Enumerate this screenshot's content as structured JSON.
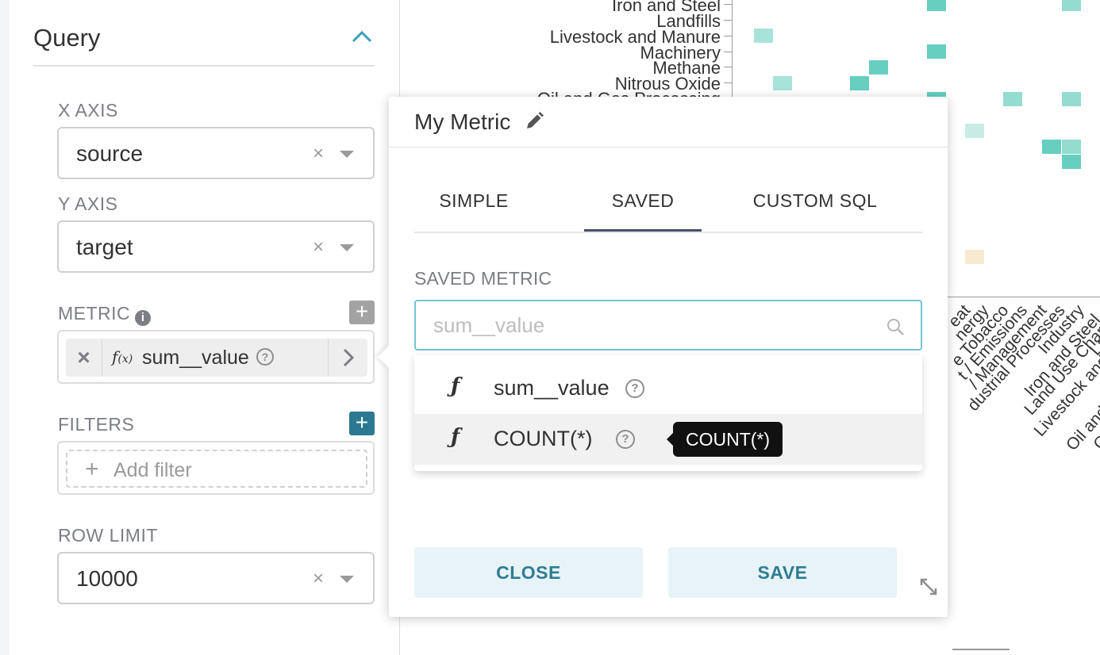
{
  "query": {
    "title": "Query",
    "x_axis": {
      "label": "X AXIS",
      "value": "source",
      "clear": "×"
    },
    "y_axis": {
      "label": "Y AXIS",
      "value": "target",
      "clear": "×"
    },
    "metric": {
      "label": "METRIC",
      "info": "i",
      "add": "+",
      "remove": "×",
      "fx": "f",
      "fx_sub": "(x)",
      "value": "sum__value",
      "help": "?"
    },
    "filters": {
      "label": "FILTERS",
      "add": "+",
      "add_plus": "+",
      "add_label": "Add filter"
    },
    "row_limit": {
      "label": "ROW LIMIT",
      "value": "10000",
      "clear": "×"
    }
  },
  "chart": {
    "y_labels": [
      "Iron and Steel",
      "Landfills",
      "Livestock and Manure",
      "Machinery",
      "Methane",
      "Nitrous Oxide",
      "Oil and Gas Processing"
    ],
    "x_labels": [
      "eat",
      "nergy",
      "e Tobacco",
      "t / Emissions",
      "/ Management",
      "dustrial Processes",
      "Industry",
      "Iron and Steel",
      "Land Use Chan",
      "Livestock and",
      "La",
      "Oil and",
      "O"
    ],
    "colors": {
      "strong": "#66cfc0",
      "medium": "#93dccf",
      "light": "#c6ece5",
      "beige": "#f7ead0"
    }
  },
  "popover": {
    "title": "My Metric",
    "tabs": [
      {
        "label": "SIMPLE"
      },
      {
        "label": "SAVED",
        "active": true
      },
      {
        "label": "CUSTOM SQL"
      }
    ],
    "saved_metric_label": "SAVED METRIC",
    "search_placeholder": "sum__value",
    "options": [
      {
        "icon": "ƒ",
        "label": "sum__value",
        "help": "?"
      },
      {
        "icon": "ƒ",
        "label": "COUNT(*)",
        "help": "?"
      }
    ],
    "tooltip": "COUNT(*)",
    "close_label": "CLOSE",
    "save_label": "SAVE"
  }
}
